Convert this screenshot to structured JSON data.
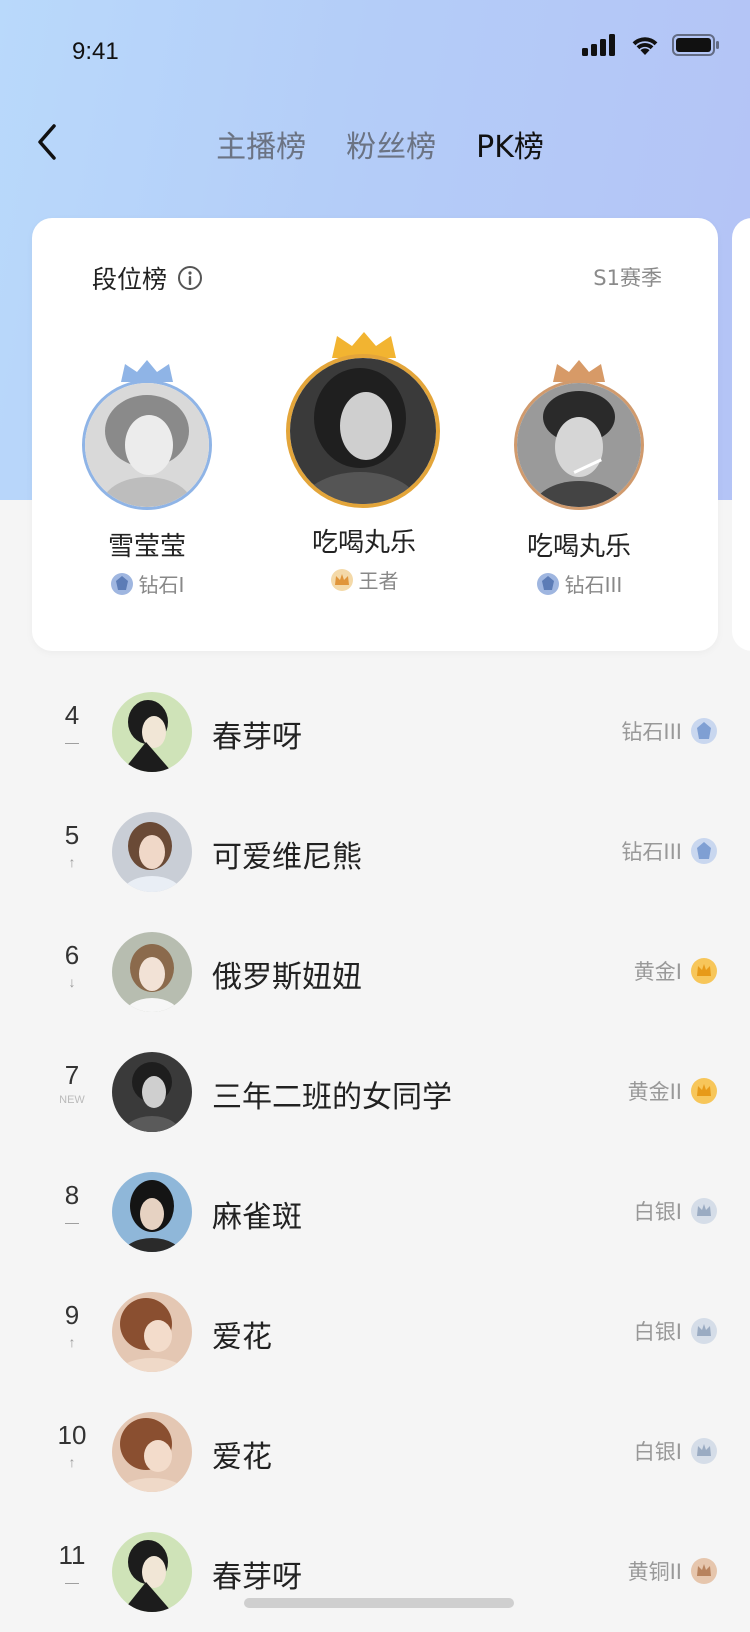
{
  "status_bar": {
    "time": "9:41"
  },
  "nav": {
    "tabs": [
      {
        "label": "主播榜",
        "active": false
      },
      {
        "label": "粉丝榜",
        "active": false
      },
      {
        "label": "PK榜",
        "active": true
      }
    ]
  },
  "card": {
    "title": "段位榜",
    "season": "S1赛季",
    "podium": [
      {
        "place": 2,
        "name": "雪莹莹",
        "tier": "钻石I",
        "crown_color": "#8fb4e6",
        "ring_color": "#8fb4e6",
        "badge_color": "#9fb6e0"
      },
      {
        "place": 1,
        "name": "吃喝丸乐",
        "tier": "王者",
        "crown_color": "#f2b431",
        "ring_color": "#e3a53a",
        "badge_color": "#e8a94b"
      },
      {
        "place": 3,
        "name": "吃喝丸乐",
        "tier": "钻石III",
        "crown_color": "#d79a67",
        "ring_color": "#d09a6d",
        "badge_color": "#9fb6e0"
      }
    ]
  },
  "list": [
    {
      "rank": "4",
      "trend": "—",
      "name": "春芽呀",
      "tier": "钻石III",
      "badge_color": "#9fb6e0"
    },
    {
      "rank": "5",
      "trend": "↑",
      "name": "可爱维尼熊",
      "tier": "钻石III",
      "badge_color": "#9fb6e0"
    },
    {
      "rank": "6",
      "trend": "↓",
      "name": "俄罗斯妞妞",
      "tier": "黄金I",
      "badge_color": "#f2b431"
    },
    {
      "rank": "7",
      "trend": "NEW",
      "name": "三年二班的女同学",
      "tier": "黄金II",
      "badge_color": "#f2b431"
    },
    {
      "rank": "8",
      "trend": "—",
      "name": "麻雀斑",
      "tier": "白银I",
      "badge_color": "#a7b8cf"
    },
    {
      "rank": "9",
      "trend": "↑",
      "name": "爱花",
      "tier": "白银I",
      "badge_color": "#a7b8cf"
    },
    {
      "rank": "10",
      "trend": "↑",
      "name": "爱花",
      "tier": "白银I",
      "badge_color": "#a7b8cf"
    },
    {
      "rank": "11",
      "trend": "—",
      "name": "春芽呀",
      "tier": "黄铜II",
      "badge_color": "#c59a78"
    }
  ]
}
